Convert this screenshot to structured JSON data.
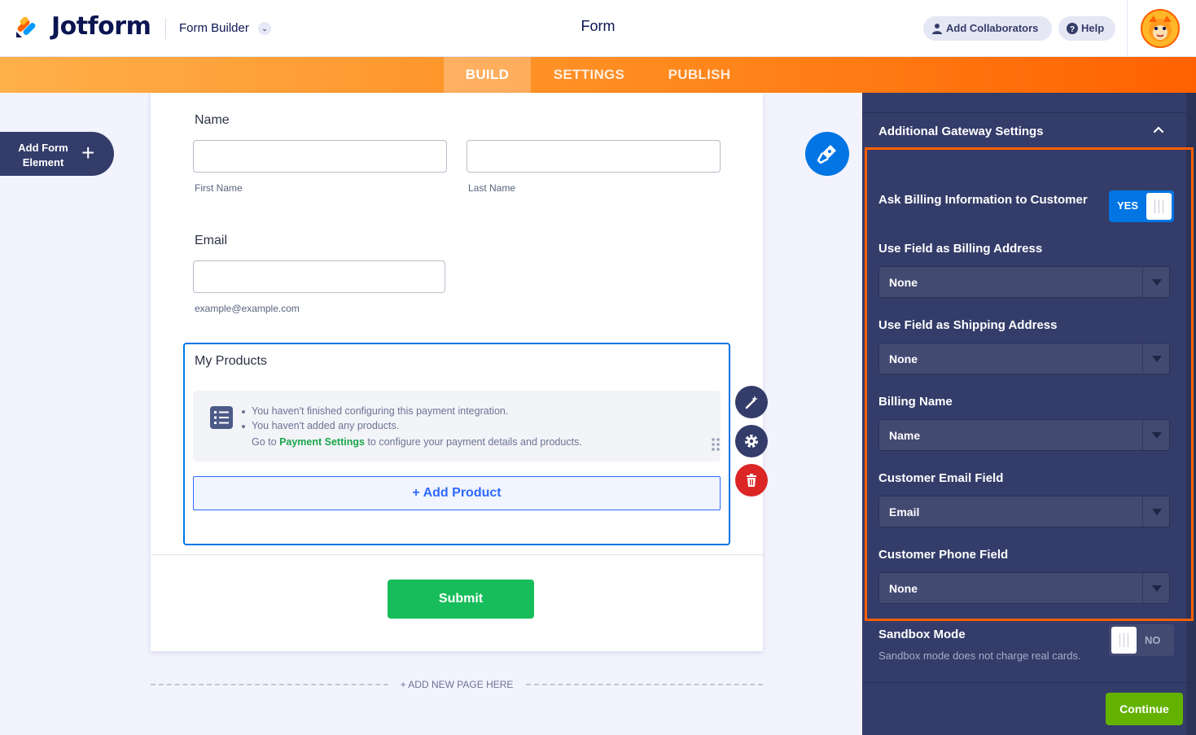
{
  "header": {
    "logo_text": "Jotform",
    "builder_label": "Form Builder",
    "form_title": "Form",
    "collaborators_label": "Add Collaborators",
    "help_label": "Help"
  },
  "tabs": [
    {
      "label": "BUILD",
      "active": true
    },
    {
      "label": "SETTINGS",
      "active": false
    },
    {
      "label": "PUBLISH",
      "active": false
    }
  ],
  "add_element": {
    "label": "Add Form Element"
  },
  "form": {
    "name_label": "Name",
    "first_name_sublabel": "First Name",
    "last_name_sublabel": "Last Name",
    "email_label": "Email",
    "email_sublabel": "example@example.com",
    "products_label": "My Products",
    "notice_1": "You haven't finished configuring this payment integration.",
    "notice_2": "You haven't added any products.",
    "goto_prefix": "Go to",
    "goto_link": "Payment Settings",
    "goto_suffix": "to configure your payment details and products.",
    "add_product": "+ Add Product",
    "submit": "Submit",
    "add_page": "+ ADD NEW PAGE HERE"
  },
  "panel": {
    "title": "Additional Gateway Settings",
    "billing_info_label": "Ask Billing Information to Customer",
    "billing_info_value": "YES",
    "billing_address_label": "Use Field as Billing Address",
    "billing_address_value": "None",
    "shipping_address_label": "Use Field as Shipping Address",
    "shipping_address_value": "None",
    "billing_name_label": "Billing Name",
    "billing_name_value": "Name",
    "email_field_label": "Customer Email Field",
    "email_field_value": "Email",
    "phone_field_label": "Customer Phone Field",
    "phone_field_value": "None",
    "sandbox_label": "Sandbox Mode",
    "sandbox_value": "NO",
    "sandbox_desc": "Sandbox mode does not charge real cards.",
    "continue": "Continue"
  },
  "colors": {
    "accent_orange": "#ff6100",
    "primary_blue": "#0075e3",
    "panel_bg": "#343c6a",
    "submit_green": "#18bd5b",
    "continue_green": "#64b200",
    "delete_red": "#dc2626"
  }
}
